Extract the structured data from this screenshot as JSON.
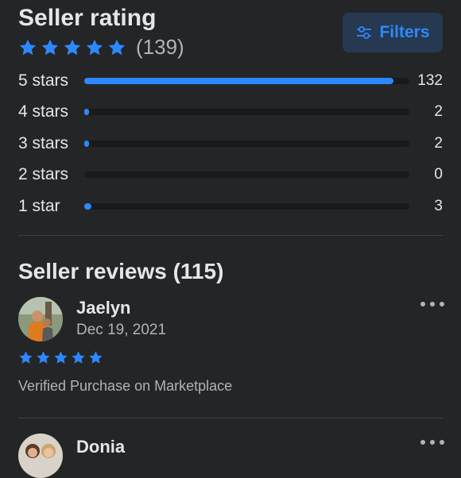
{
  "header": {
    "title": "Seller rating",
    "review_count": "(139)",
    "star_count": 5,
    "filters_label": "Filters"
  },
  "breakdown": [
    {
      "label": "5 stars",
      "count": "132",
      "fraction": 0.95
    },
    {
      "label": "4 stars",
      "count": "2",
      "fraction": 0.014
    },
    {
      "label": "3 stars",
      "count": "2",
      "fraction": 0.014
    },
    {
      "label": "2 stars",
      "count": "0",
      "fraction": 0
    },
    {
      "label": "1 star",
      "count": "3",
      "fraction": 0.022
    }
  ],
  "reviews_section": {
    "title": "Seller reviews (115)"
  },
  "reviews": [
    {
      "name": "Jaelyn",
      "date": "Dec 19, 2021",
      "stars": 5,
      "text": "Verified Purchase on Marketplace"
    },
    {
      "name": "Donia"
    }
  ],
  "colors": {
    "accent": "#2d88ff",
    "background": "#242526",
    "track": "#18191a",
    "button_bg": "#263951"
  }
}
